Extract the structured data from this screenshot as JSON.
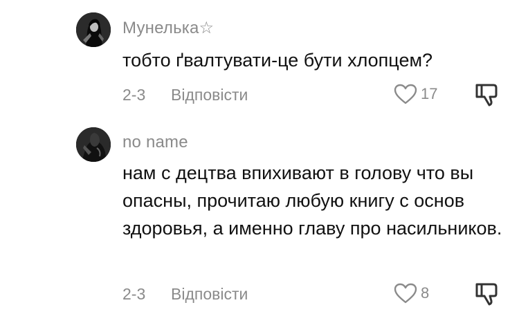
{
  "comments": [
    {
      "username": "Мунелька☆",
      "text": "тобто ґвалтувати-це бути хлопцем?",
      "date": "2-3",
      "reply_label": "Відповісти",
      "likes": "17"
    },
    {
      "username": "no name",
      "text": "нам с децтва впихивают в голову что вы опасны, прочитаю любую книгу с основ здоровья, а именно главу про насильников.",
      "date": "2-3",
      "reply_label": "Відповісти",
      "likes": "8"
    }
  ],
  "icons": {
    "like": "heart-outline-icon",
    "dislike": "thumbs-down-outline-icon"
  },
  "colors": {
    "secondary_text": "#8a8a8a",
    "primary_text": "#111111",
    "background": "#ffffff"
  }
}
